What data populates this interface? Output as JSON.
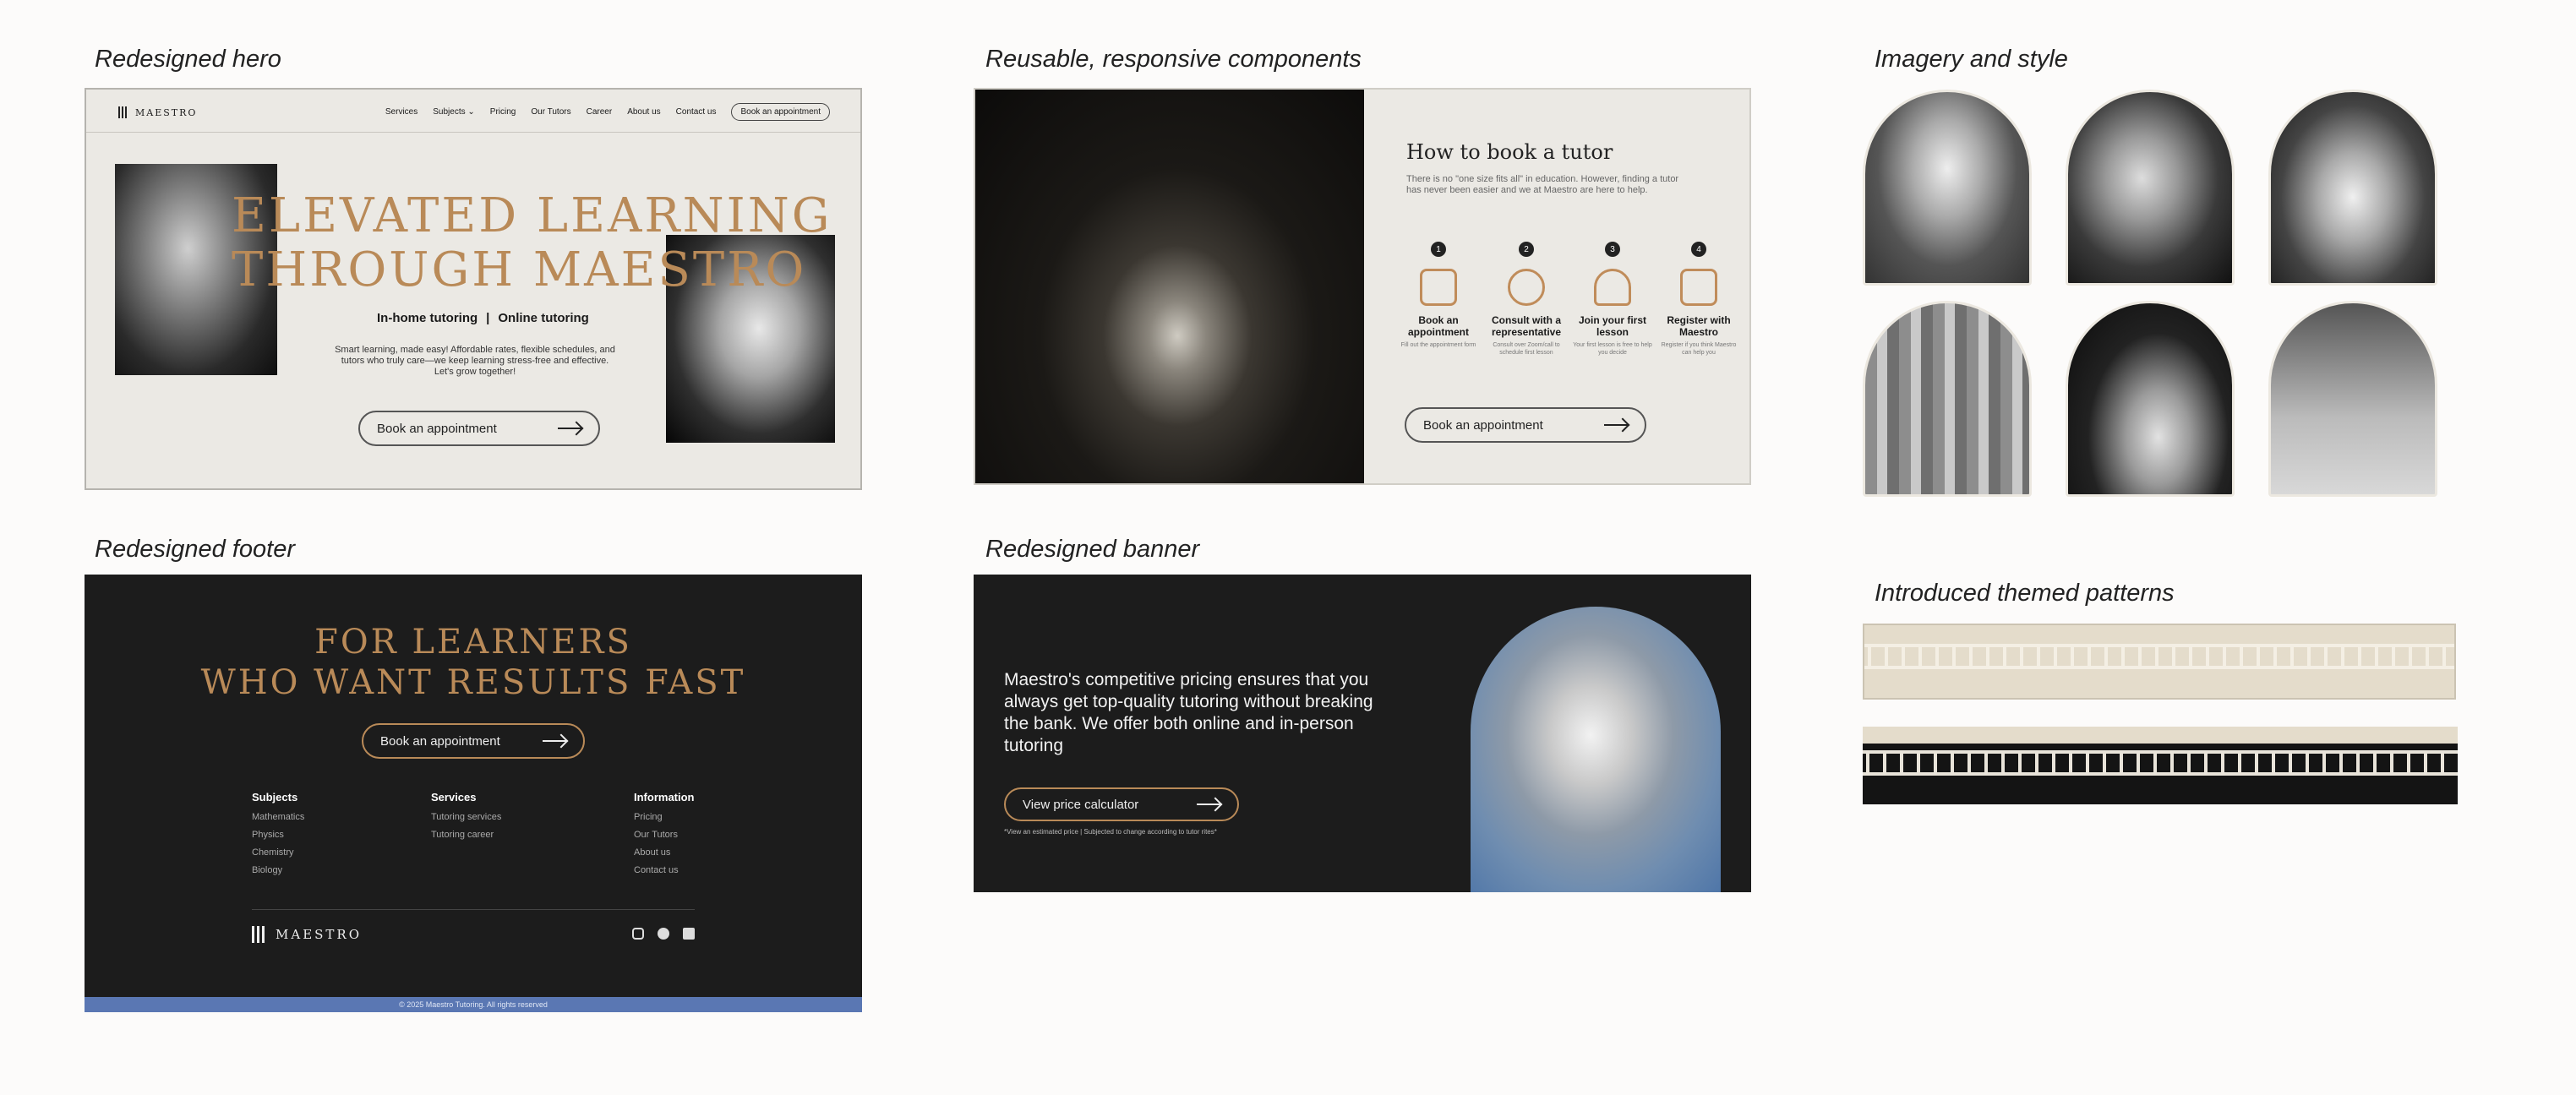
{
  "labels": {
    "hero": "Redesigned hero",
    "components": "Reusable, responsive components",
    "imagery": "Imagery and style",
    "footer": "Redesigned footer",
    "banner": "Redesigned banner",
    "patterns": "Introduced themed patterns"
  },
  "hero": {
    "logo": "MAESTRO",
    "nav": [
      "Services",
      "Subjects",
      "Pricing",
      "Our Tutors",
      "Career",
      "About us",
      "Contact us"
    ],
    "nav_cta": "Book an appointment",
    "headline_1": "ELEVATED LEARNING",
    "headline_2": "THROUGH MAESTRO",
    "modes_a": "In-home tutoring",
    "modes_sep": "|",
    "modes_b": "Online tutoring",
    "body_1": "Smart learning, made easy! Affordable rates, flexible schedules, and",
    "body_2": "tutors who truly care—we keep learning stress-free and effective.",
    "body_3": "Let's grow together!",
    "cta": "Book an appointment"
  },
  "components": {
    "title": "How to book a tutor",
    "intro_1": "There is no \"one size fits all\" in education. However, finding a tutor",
    "intro_2": "has never been easier and we at Maestro are here to help.",
    "steps": [
      {
        "num": "1",
        "title": "Book an appointment",
        "sub": "Fill out the appointment form"
      },
      {
        "num": "2",
        "title": "Consult with a representative",
        "sub": "Consult over Zoom/call to schedule first lesson"
      },
      {
        "num": "3",
        "title": "Join your first lesson",
        "sub": "Your first lesson is free to help you decide"
      },
      {
        "num": "4",
        "title": "Register with Maestro",
        "sub": "Register if you think Maestro can help you"
      }
    ],
    "cta": "Book an appointment"
  },
  "footer": {
    "headline_1": "FOR LEARNERS",
    "headline_2": "WHO WANT RESULTS FAST",
    "cta": "Book an appointment",
    "cols": [
      {
        "title": "Subjects",
        "items": [
          "Mathematics",
          "Physics",
          "Chemistry",
          "Biology"
        ]
      },
      {
        "title": "Services",
        "items": [
          "Tutoring services",
          "Tutoring career"
        ]
      },
      {
        "title": "Information",
        "items": [
          "Pricing",
          "Our Tutors",
          "About us",
          "Contact us"
        ]
      }
    ],
    "logo": "MAESTRO",
    "copyright": "© 2025 Maestro Tutoring. All rights reserved"
  },
  "banner": {
    "text_1": "Maestro's competitive pricing ensures that you",
    "text_2": "always get top-quality tutoring without breaking",
    "text_3": "the bank. We offer both online and in-person",
    "text_4": "tutoring",
    "cta": "View price calculator",
    "note": "*View an estimated price | Subjected to change according to tutor rites*"
  },
  "colors": {
    "gold": "#b98a58",
    "cream": "#ebe9e4",
    "dark": "#1c1c1c",
    "footer_bar": "#5a77b3",
    "pattern_light": "#e4dccb"
  }
}
